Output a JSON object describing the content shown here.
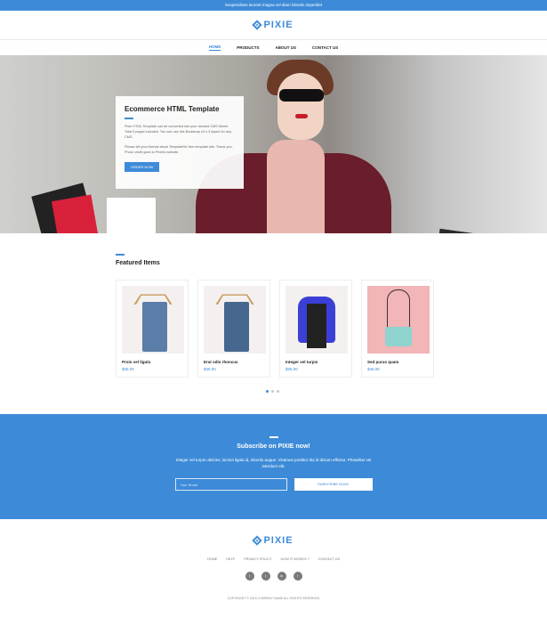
{
  "topbar": {
    "text": "Suspendisse laoreet magna vel diam lobortis imperdiet"
  },
  "brand": {
    "name": "PIXIE"
  },
  "nav": {
    "items": [
      "HOME",
      "PRODUCTS",
      "ABOUT US",
      "CONTACT US"
    ],
    "active": "HOME"
  },
  "hero": {
    "title": "Ecommerce HTML Template",
    "paragraph1": "Pixie HTML Template can be converted into your desired CMS theme. Total 5 pages included. You can use this Bootstrap v4.1.3 layout for any CMS.",
    "paragraph2": "Please tell your friends about TemplateMo free template site. Thank you. Photo credit goes to Pexels website.",
    "button": "ORDER NOW"
  },
  "featured": {
    "title": "Featured Items"
  },
  "products": [
    {
      "name": "Proin vel ligula",
      "price": "$35.00",
      "image": "hanging-jeans"
    },
    {
      "name": "Erat odio rhoncus",
      "price": "$35.00",
      "image": "hanging-jeans-dark"
    },
    {
      "name": "Integer vel turpis",
      "price": "$35.00",
      "image": "blue-vest"
    },
    {
      "name": "Sed purus quam",
      "price": "$45.00",
      "image": "mint-purse"
    }
  ],
  "subscribe": {
    "title": "Subscribe on PIXIE now!",
    "text": "Integer vel turpis ultricies, lacinia ligula id, lobortis augue. Vivamus porttitor dui id dictum efficitur. Phasellus vel interdum elit.",
    "email_placeholder": "Your Email",
    "button": "SUBSCRIBE NOW!"
  },
  "footer": {
    "links": [
      "HOME",
      "HELP",
      "PRIVACY POLICY",
      "HOW IT WORKS ?",
      "CONTACT US"
    ],
    "socials": [
      "facebook-icon",
      "twitter-icon",
      "linkedin-icon",
      "rss-icon"
    ],
    "copyright": "COPYRIGHT © 2019 COMPANY NAME ALL RIGHTS RESERVED"
  },
  "colors": {
    "accent": "#3d8bd8"
  }
}
